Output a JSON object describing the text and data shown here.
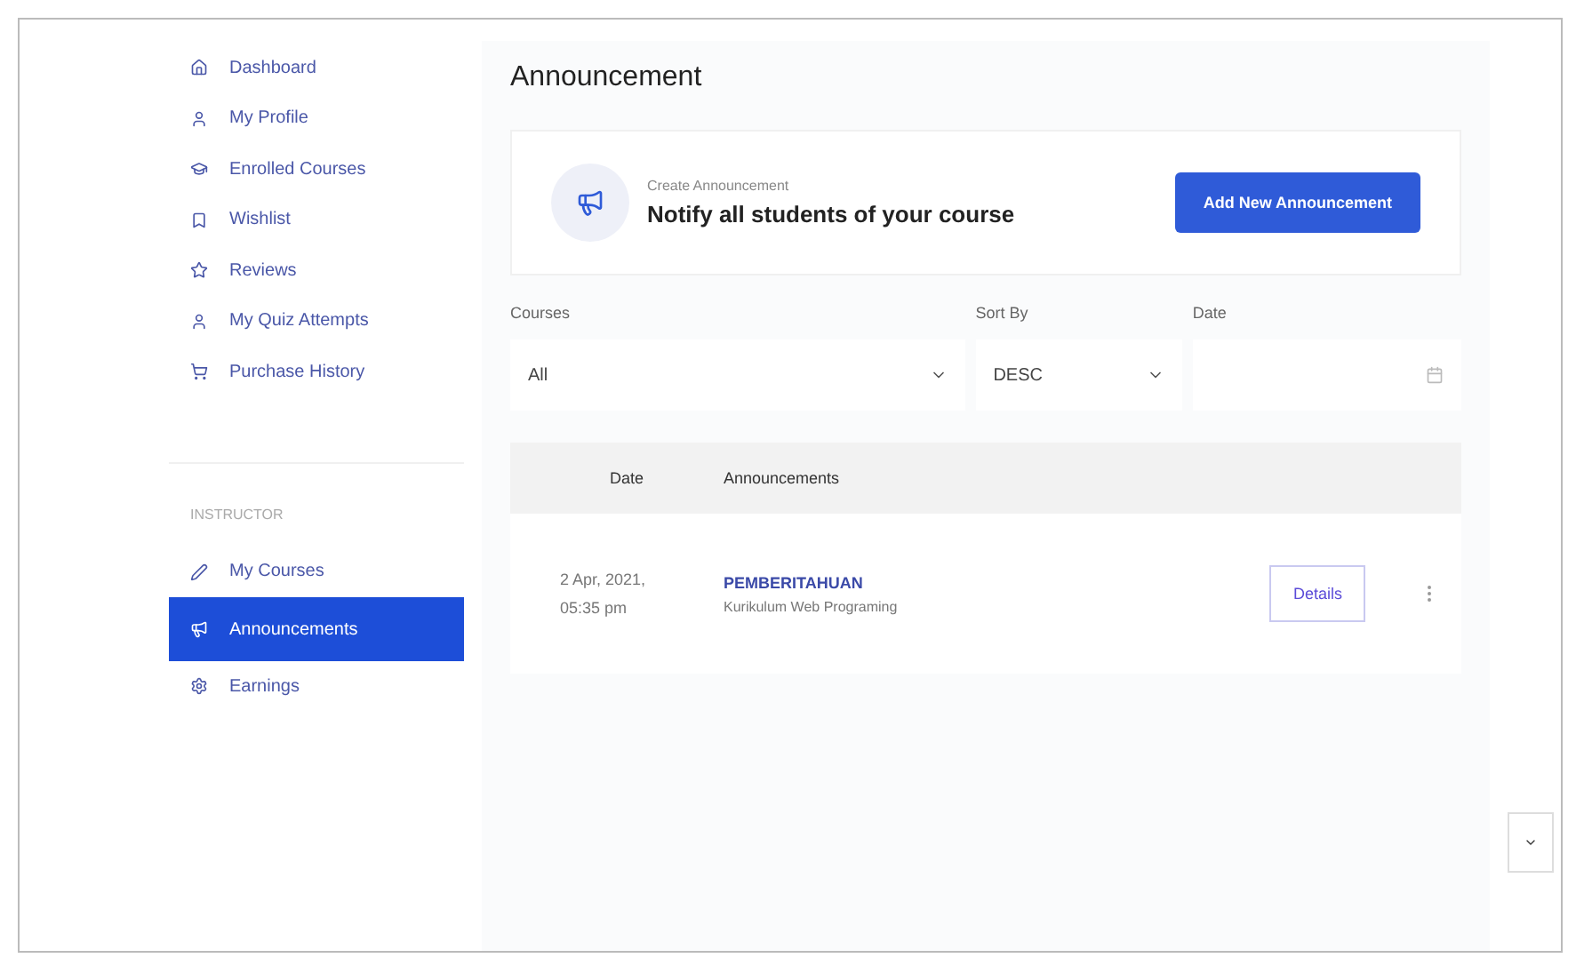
{
  "sidebar": {
    "items": [
      {
        "kind": "link",
        "label": "Dashboard",
        "selected": false
      },
      {
        "kind": "link",
        "label": "My Profile",
        "selected": false
      },
      {
        "kind": "link",
        "label": "Enrolled Courses",
        "selected": false
      },
      {
        "kind": "link",
        "label": "Wishlist",
        "selected": false
      },
      {
        "kind": "link",
        "label": "Reviews",
        "selected": false
      },
      {
        "kind": "link",
        "label": "My Quiz Attempts",
        "selected": false
      },
      {
        "kind": "link",
        "label": "Purchase History",
        "selected": false
      },
      {
        "kind": "heading",
        "label": "INSTRUCTOR"
      },
      {
        "kind": "link",
        "label": "My Courses",
        "selected": false
      },
      {
        "kind": "link",
        "label": "Announcements",
        "selected": true
      },
      {
        "kind": "link",
        "label": "Earnings",
        "selected": false
      }
    ]
  },
  "page_title": "Announcement",
  "create_card": {
    "caption": "Create Announcement",
    "headline": "Notify all students of your course",
    "button": "Add New Announcement"
  },
  "filters": [
    {
      "kind": "select",
      "label": "Courses",
      "value": "All"
    },
    {
      "kind": "select",
      "label": "Sort By",
      "value": "DESC"
    },
    {
      "kind": "date",
      "label": "Date"
    }
  ],
  "table": {
    "columns": [
      "Date",
      "Announcements"
    ],
    "rows": [
      {
        "date": "2 Apr, 2021,",
        "time": "05:35 pm",
        "title": "PEMBERITAHUAN",
        "course": "Kurikulum Web Programing",
        "button": "Details"
      }
    ]
  }
}
